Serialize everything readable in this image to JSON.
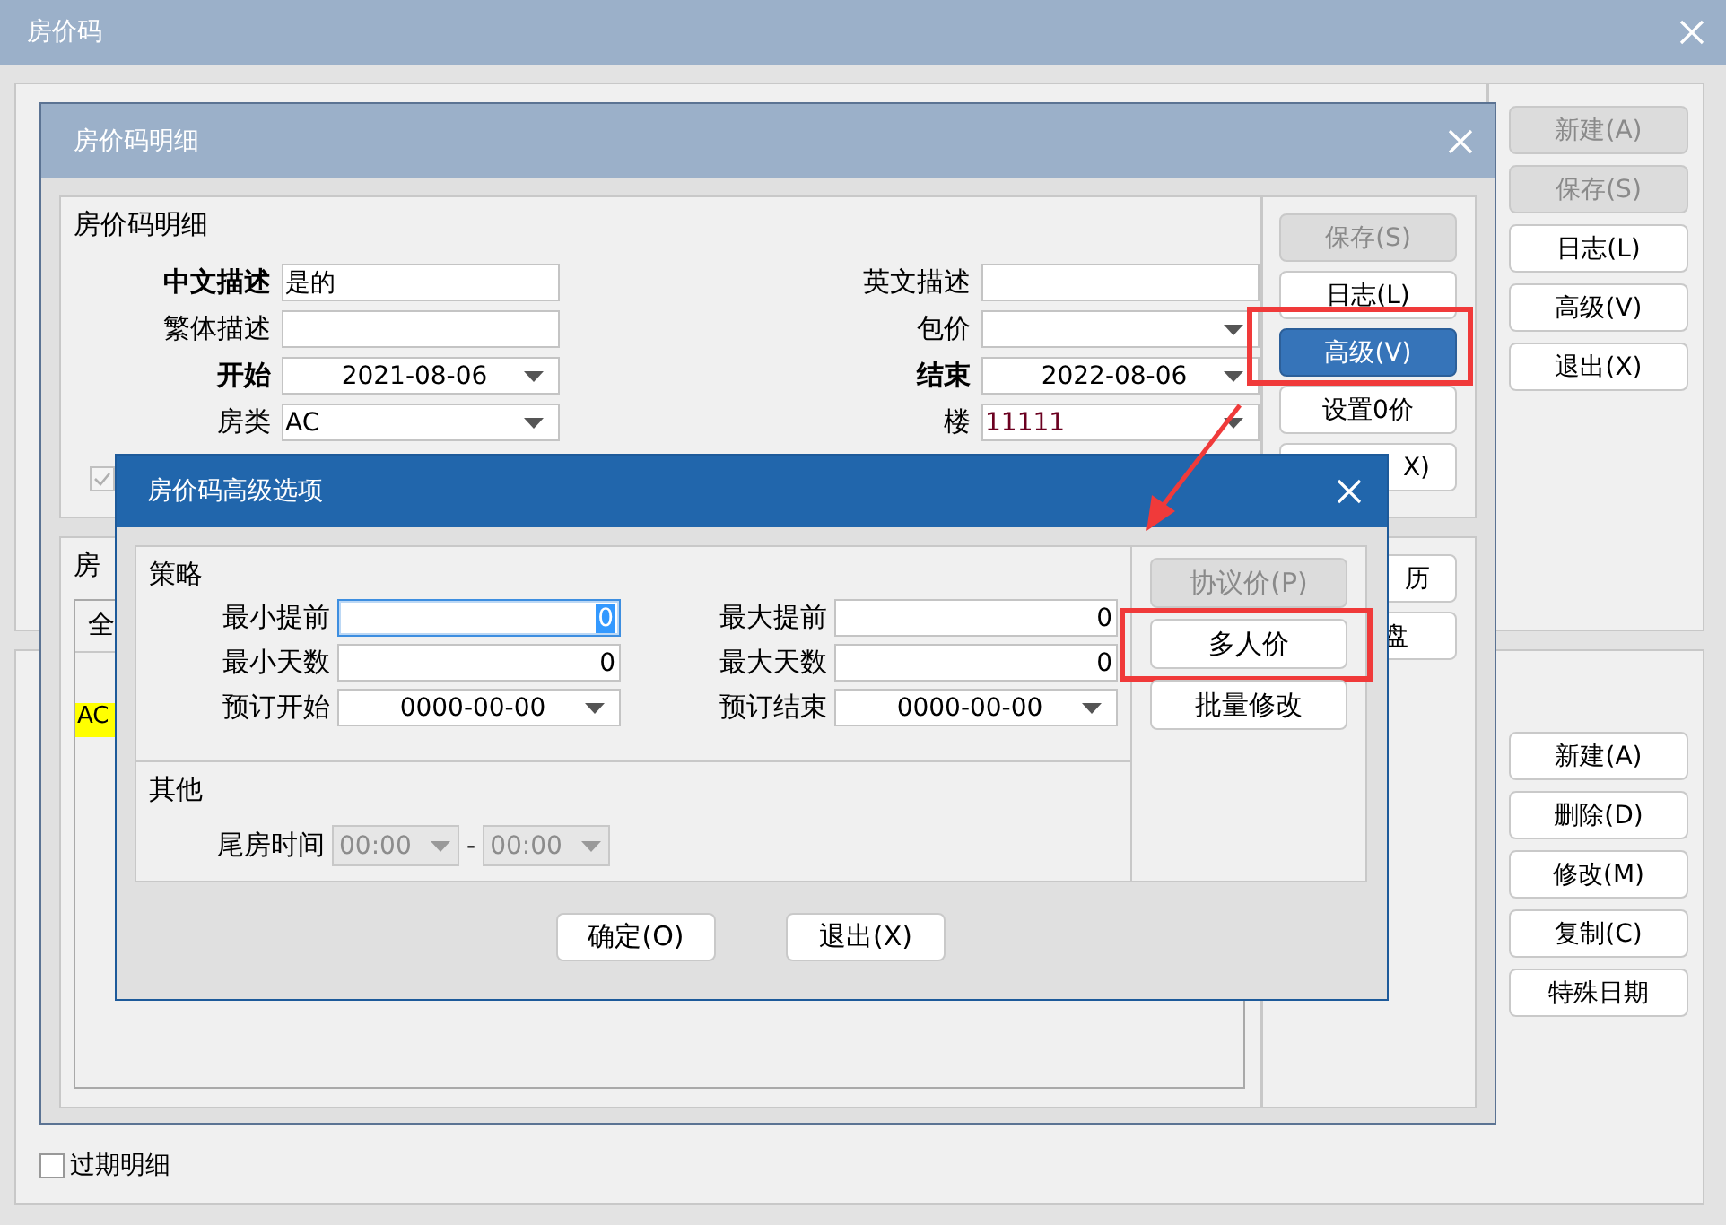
{
  "main_window": {
    "title": "房价码",
    "upper_buttons": [
      {
        "label": "新建(A)",
        "disabled": true
      },
      {
        "label": "保存(S)",
        "disabled": true
      },
      {
        "label": "日志(L)",
        "disabled": false
      },
      {
        "label": "高级(V)",
        "disabled": false
      },
      {
        "label": "退出(X)",
        "disabled": false
      }
    ],
    "lower_buttons": [
      {
        "label": "新建(A)",
        "disabled": false
      },
      {
        "label": "删除(D)",
        "disabled": false
      },
      {
        "label": "修改(M)",
        "disabled": false
      },
      {
        "label": "复制(C)",
        "disabled": false
      },
      {
        "label": "特殊日期",
        "disabled": false
      }
    ],
    "expired_detail": {
      "label": "过期明细",
      "checked": false
    }
  },
  "detail_window": {
    "title": "房价码明细",
    "group_title": "房价码明细",
    "fields": [
      {
        "label": "中文描述",
        "bold": true,
        "kind": "text",
        "value": "是的"
      },
      {
        "label": "英文描述",
        "bold": false,
        "kind": "text"
      },
      {
        "label": "繁体描述",
        "bold": false,
        "kind": "text"
      },
      {
        "label": "包价",
        "bold": false,
        "kind": "select"
      },
      {
        "label": "开始",
        "bold": true,
        "kind": "date",
        "value": "2021-08-06"
      },
      {
        "label": "结束",
        "bold": true,
        "kind": "date",
        "value": "2022-08-06"
      },
      {
        "label": "房类",
        "bold": false,
        "kind": "select",
        "value": "AC"
      },
      {
        "label": "楼",
        "bold": false,
        "kind": "select",
        "value": "11111"
      }
    ],
    "checkbox": {
      "checked": true,
      "disabled": true
    },
    "buttons": [
      {
        "label": "保存(S)",
        "disabled": true,
        "selected": false,
        "highlighted": false
      },
      {
        "label": "日志(L)",
        "disabled": false,
        "selected": false,
        "highlighted": false
      },
      {
        "label": "高级(V)",
        "disabled": false,
        "selected": true,
        "highlighted": true
      },
      {
        "label": "设置0价",
        "disabled": false,
        "selected": false,
        "highlighted": false
      },
      {
        "label": "X)",
        "disabled": false,
        "selected": false,
        "highlighted": false
      }
    ],
    "lower_group": {
      "title": "房",
      "tab": "全",
      "cell": "AC",
      "buttons": [
        "历",
        "盘"
      ]
    }
  },
  "advanced_dialog": {
    "title": "房价码高级选项",
    "strategy": {
      "title": "策略",
      "rows": [
        {
          "label": "最小提前",
          "kind": "number",
          "value": "0",
          "selected": true
        },
        {
          "label": "最大提前",
          "kind": "number",
          "value": "0",
          "selected": false
        },
        {
          "label": "最小天数",
          "kind": "number",
          "value": "0",
          "selected": false
        },
        {
          "label": "最大天数",
          "kind": "number",
          "value": "0",
          "selected": false
        },
        {
          "label": "预订开始",
          "kind": "date",
          "value": "0000-00-00",
          "selected": false
        },
        {
          "label": "预订结束",
          "kind": "date",
          "value": "0000-00-00",
          "selected": false
        }
      ]
    },
    "other": {
      "title": "其他",
      "label": "尾房时间",
      "from": "00:00",
      "separator": "-",
      "to": "00:00",
      "disabled": true
    },
    "side_buttons": [
      {
        "label": "协议价(P)",
        "disabled": true,
        "highlighted": false
      },
      {
        "label": "多人价",
        "disabled": false,
        "highlighted": true
      },
      {
        "label": "批量修改",
        "disabled": false,
        "highlighted": false
      }
    ],
    "footer_buttons": [
      "确定(O)",
      "退出(X)"
    ]
  },
  "annotation_arrow": true
}
